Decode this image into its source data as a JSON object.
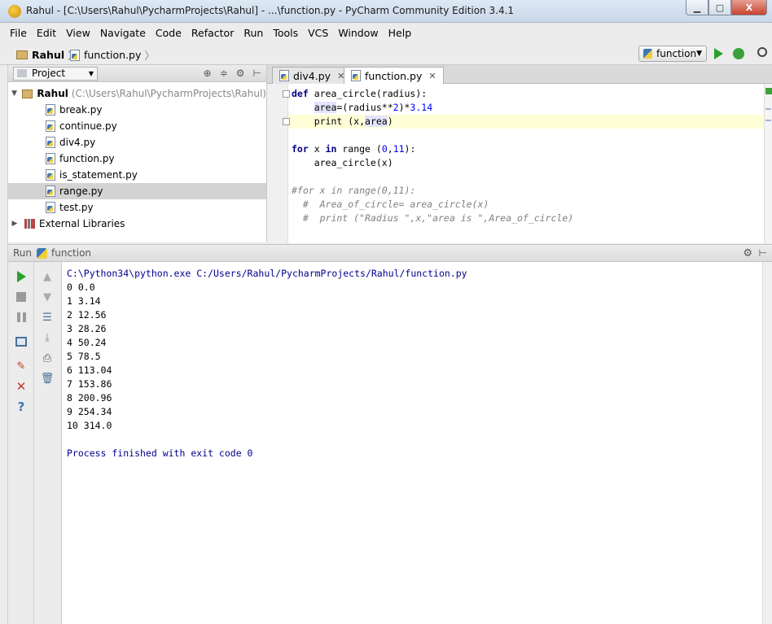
{
  "window": {
    "title": "Rahul - [C:\\Users\\Rahul\\PycharmProjects\\Rahul] - ...\\function.py - PyCharm Community Edition 3.4.1",
    "min_label": "▁",
    "max_label": "▢",
    "close_label": "X"
  },
  "menu": [
    "File",
    "Edit",
    "View",
    "Navigate",
    "Code",
    "Refactor",
    "Run",
    "Tools",
    "VCS",
    "Window",
    "Help"
  ],
  "breadcrumb": {
    "project": "Rahul",
    "file": "function.py"
  },
  "run_config": {
    "name": "function"
  },
  "project_panel": {
    "selector_label": "Project",
    "root_name": "Rahul",
    "root_path": "(C:\\Users\\Rahul\\PycharmProjects\\Rahul)",
    "files": [
      "break.py",
      "continue.py",
      "div4.py",
      "function.py",
      "is_statement.py",
      "range.py",
      "test.py"
    ],
    "selected_file": "range.py",
    "external": "External Libraries"
  },
  "editor": {
    "tabs": [
      {
        "label": "div4.py",
        "active": false
      },
      {
        "label": "function.py",
        "active": true
      }
    ]
  },
  "run_panel": {
    "label": "Run",
    "config_name": "function",
    "command": "C:\\Python34\\python.exe C:/Users/Rahul/PycharmProjects/Rahul/function.py",
    "output": [
      "0 0.0",
      "1 3.14",
      "2 12.56",
      "3 28.26",
      "4 50.24",
      "5 78.5",
      "6 113.04",
      "7 153.86",
      "8 200.96",
      "9 254.34",
      "10 314.0"
    ],
    "exit_message": "Process finished with exit code 0"
  },
  "colors": {
    "keyword": "#000080",
    "number": "#0000ff",
    "comment": "#808080",
    "current_line": "#ffffd7",
    "run_green": "#2aa12e"
  }
}
